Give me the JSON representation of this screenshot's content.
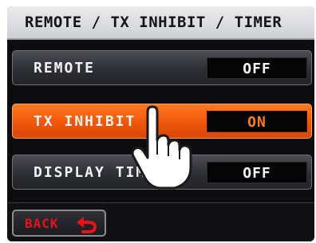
{
  "screen": {
    "title": "REMOTE / TX INHIBIT / TIMER"
  },
  "menu": {
    "items": [
      {
        "label": "REMOTE",
        "value": "OFF",
        "active": false
      },
      {
        "label": "TX INHIBIT",
        "value": "ON",
        "active": true
      },
      {
        "label": "DISPLAY TIMER",
        "value": "OFF",
        "active": false
      }
    ]
  },
  "footer": {
    "back_label": "BACK",
    "back_icon": "return-arrow-icon"
  },
  "overlay": {
    "pointer_icon": "pointing-hand-icon"
  },
  "colors": {
    "active_row": "#f0560a",
    "back_text": "#e5131a",
    "title_bar": "#e0e1e6",
    "screen_bg": "#0d0d0f"
  }
}
